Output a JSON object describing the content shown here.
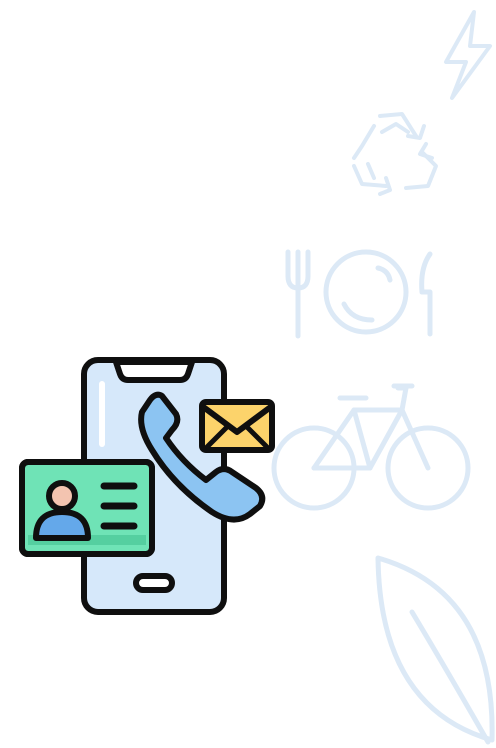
{
  "palette": {
    "background": "#ffffff",
    "watermark": "#dce9f6",
    "outline": "#0f0f0f",
    "phone_body": "#d6e8fa",
    "handset": "#8cc4f2",
    "envelope": "#fcd36b",
    "id_card": "#6fe3b6",
    "skin": "#f3c4b0",
    "person_body": "#64a8ea"
  },
  "background_icons": [
    "lightning-bolt-icon",
    "recycle-icon",
    "fork-plate-knife-icon",
    "bicycle-icon",
    "leaf-icon"
  ],
  "illustration_parts": [
    "smartphone-icon",
    "phone-handset-icon",
    "envelope-icon",
    "contact-card-icon"
  ]
}
